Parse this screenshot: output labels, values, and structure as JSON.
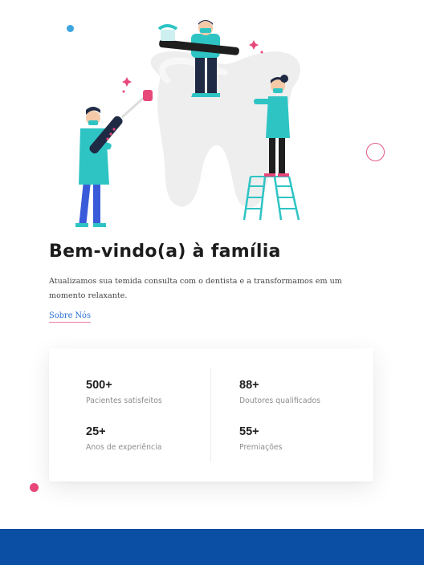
{
  "welcome": {
    "title": "Bem-vindo(a) à família",
    "text": "Atualizamos sua temida consulta com o dentista e a transformamos em um momento relaxante.",
    "link_label": "Sobre Nós"
  },
  "stats": [
    {
      "number": "500+",
      "label": "Pacientes satisfeitos"
    },
    {
      "number": "88+",
      "label": "Doutores qualificados"
    },
    {
      "number": "25+",
      "label": "Anos de experiência"
    },
    {
      "number": "55+",
      "label": "Premiações"
    }
  ],
  "colors": {
    "accent_pink": "#e8477a",
    "accent_blue": "#3ea6df",
    "link_blue": "#2a6fd6",
    "teal": "#2ec4c4",
    "footer_blue": "#0a4fa3"
  },
  "icons": {
    "illustration": "dentists-cleaning-giant-tooth"
  }
}
